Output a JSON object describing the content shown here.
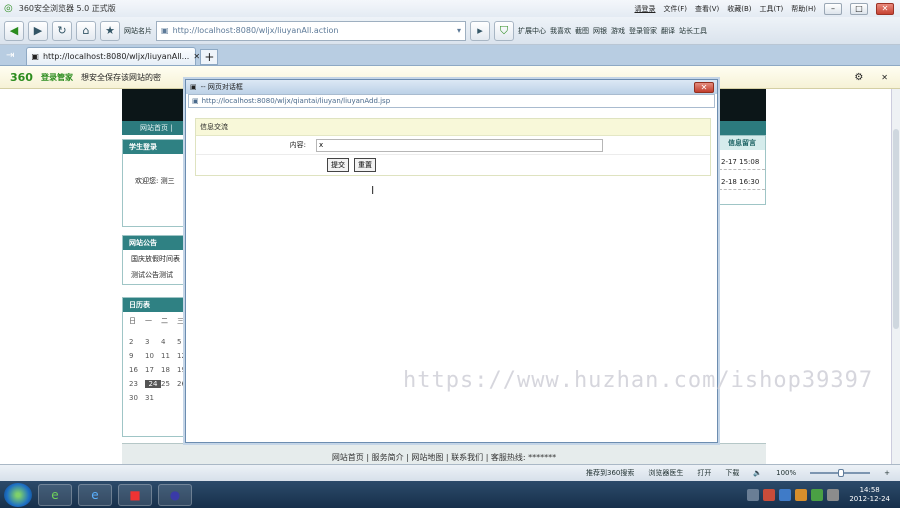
{
  "titlebar": {
    "title": "360安全浏览器 5.0 正式版",
    "login": "请登录",
    "menus": [
      "文件(F)",
      "查看(V)",
      "收藏(B)",
      "工具(T)",
      "帮助(H)"
    ]
  },
  "navbar": {
    "favorites_label": "网站名片",
    "address": "http://localhost:8080/wljx/liuyanAll.action",
    "toolbar": [
      "扩展中心",
      "我喜欢",
      "截图",
      "网银",
      "游戏",
      "登录管家",
      "翻译",
      "站长工具"
    ]
  },
  "tabs": [
    {
      "label": "http://localhost:8080/wljx/liuyanAll..."
    }
  ],
  "secbar": {
    "logo": "360",
    "brand": "登录管家",
    "message": "想安全保存该网站的密"
  },
  "page": {
    "nav_text": "网站首页 |",
    "login_panel": {
      "header": "学生登录",
      "welcome": "欢迎您: 测三"
    },
    "notice_panel": {
      "header": "网站公告",
      "items": [
        "国庆放假时间表",
        "测试公告测试"
      ]
    },
    "calendar_panel": {
      "header": "日历表",
      "weekdays": [
        "日",
        "一",
        "二",
        "三"
      ],
      "days": [
        "2",
        "3",
        "4",
        "5",
        "9",
        "10",
        "11",
        "12",
        "16",
        "17",
        "18",
        "19",
        "23",
        "24",
        "25",
        "26",
        "30",
        "31"
      ],
      "today": "24"
    },
    "right_panel": {
      "header": "信息留言",
      "rows": [
        "2-17 15:08",
        "2-18 16:30"
      ]
    },
    "footer": "网站首页 | 服务简介 | 网站地图 | 联系我们 | 客服热线: *******"
  },
  "dialog": {
    "title": "-- 网页对话框",
    "url": "http://localhost:8080/wljx/qiantai/liuyan/liuyanAdd.jsp",
    "form_header": "信息交流",
    "content_label": "内容:",
    "content_value": "x",
    "submit_label": "提交",
    "reset_label": "重置"
  },
  "watermark": "https://www.huzhan.com/ishop39397",
  "status": {
    "recommend": "推荐到360搜索",
    "doctor": "浏览器医生",
    "open": "打开",
    "download": "下载",
    "zoom": "100%"
  },
  "taskbar": {
    "time": "14:58",
    "date": "2012-12-24"
  }
}
